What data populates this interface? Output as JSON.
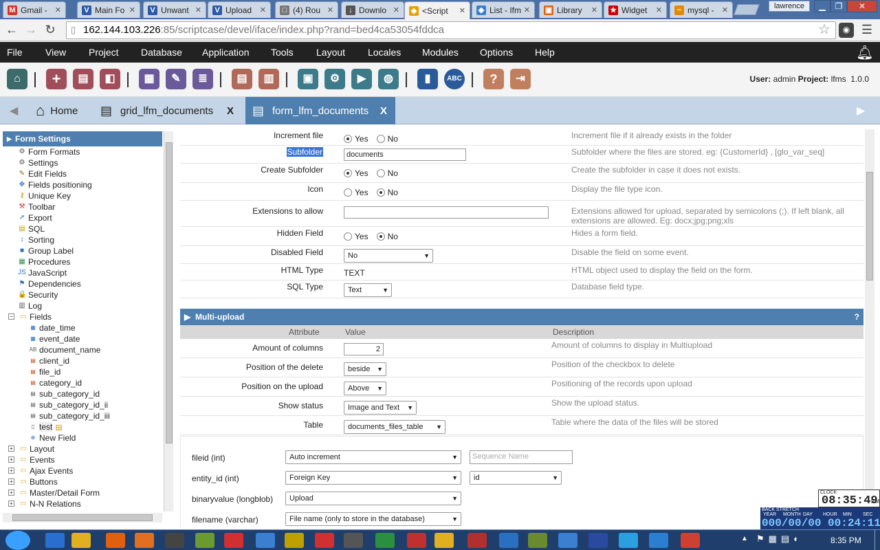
{
  "browser": {
    "tabs": [
      {
        "title": "Gmail -",
        "fav": "M",
        "color": "#d93025"
      },
      {
        "title": "Main Fo",
        "fav": "V",
        "color": "#2a5aa8"
      },
      {
        "title": "Unwant",
        "fav": "V",
        "color": "#2a5aa8"
      },
      {
        "title": "Upload",
        "fav": "V",
        "color": "#2a5aa8"
      },
      {
        "title": "(4) Rou",
        "fav": "□",
        "color": "#777"
      },
      {
        "title": "Downlo",
        "fav": "↓",
        "color": "#555"
      },
      {
        "title": "<Script",
        "fav": "◆",
        "color": "#e8a100"
      },
      {
        "title": "List - Ifm",
        "fav": "◆",
        "color": "#3a7fd0"
      },
      {
        "title": "Library",
        "fav": "▣",
        "color": "#e06010"
      },
      {
        "title": "Widget",
        "fav": "★",
        "color": "#c00"
      },
      {
        "title": "mysql -",
        "fav": "~",
        "color": "#e28b00"
      }
    ],
    "user": "lawrence",
    "url_host": "162.144.103.226",
    "url_path": ":85/scriptcase/devel/iface/index.php?rand=bed4ca53054fddca"
  },
  "menu": [
    "File",
    "View",
    "Project",
    "Database",
    "Application",
    "Tools",
    "Layout",
    "Locales",
    "Modules",
    "Options",
    "Help"
  ],
  "userinfo": {
    "user_label": "User:",
    "user": "admin",
    "project_label": "Project:",
    "project": "lfms",
    "version": "1.0.0"
  },
  "project_tabs": {
    "home": "Home",
    "grid": "grid_lfm_documents",
    "form": "form_lfm_documents",
    "close": "X"
  },
  "tree": {
    "header": "Form Settings",
    "items": [
      {
        "label": "Form Formats",
        "icon": "⚙",
        "c": "#555"
      },
      {
        "label": "Settings",
        "icon": "⚙",
        "c": "#555"
      },
      {
        "label": "Edit Fields",
        "icon": "✎",
        "c": "#a06000"
      },
      {
        "label": "Fields positioning",
        "icon": "✥",
        "c": "#2a70c0"
      },
      {
        "label": "Unique Key",
        "icon": "⚷",
        "c": "#c09000"
      },
      {
        "label": "Toolbar",
        "icon": "⚒",
        "c": "#c03030"
      },
      {
        "label": "Export",
        "icon": "➚",
        "c": "#2a70c0"
      },
      {
        "label": "SQL",
        "icon": "▤",
        "c": "#c0a000"
      },
      {
        "label": "Sorting",
        "icon": "↕",
        "c": "#2a70c0"
      },
      {
        "label": "Group Label",
        "icon": "■",
        "c": "#2a70c0"
      },
      {
        "label": "Procedures",
        "icon": "▦",
        "c": "#2a9040"
      },
      {
        "label": "JavaScript",
        "icon": "JS",
        "c": "#2a70c0"
      },
      {
        "label": "Dependencies",
        "icon": "⚑",
        "c": "#2a70c0"
      },
      {
        "label": "Security",
        "icon": "🔒",
        "c": "#c0a000"
      },
      {
        "label": "Log",
        "icon": "▥",
        "c": "#555"
      },
      {
        "label": "Fields",
        "icon": "▭",
        "c": "#e0b020"
      }
    ],
    "fields": [
      {
        "label": "date_time",
        "icon": "▦",
        "c": "#2a70c0"
      },
      {
        "label": "event_date",
        "icon": "▦",
        "c": "#2a70c0"
      },
      {
        "label": "document_name",
        "icon": "AB",
        "c": "#555"
      },
      {
        "label": "client_id",
        "icon": "▤",
        "c": "#c04000"
      },
      {
        "label": "file_id",
        "icon": "▤",
        "c": "#c04000"
      },
      {
        "label": "category_id",
        "icon": "▤",
        "c": "#c04000"
      },
      {
        "label": "sub_category_id",
        "icon": "▤",
        "c": "#555"
      },
      {
        "label": "sub_category_id_ii",
        "icon": "▤",
        "c": "#555"
      },
      {
        "label": "sub_category_id_iii",
        "icon": "▤",
        "c": "#555"
      },
      {
        "label": "test",
        "icon": "▯",
        "c": "#555"
      },
      {
        "label": "New Field",
        "icon": "⊕",
        "c": "#2a70c0"
      }
    ],
    "groups": [
      "Layout",
      "Events",
      "Ajax Events",
      "Buttons",
      "Master/Detail Form",
      "N-N Relations"
    ]
  },
  "form": {
    "rows": [
      {
        "label": "Increment file",
        "type": "radio",
        "selected": "Yes",
        "desc": "Increment file if it already exists in the folder"
      },
      {
        "label": "Subfolder",
        "type": "text",
        "value": "documents",
        "desc": "Subfolder where the files are stored. eg: {CustomerId} , [glo_var_seq]"
      },
      {
        "label": "Create Subfolder",
        "type": "radio",
        "selected": "Yes",
        "desc": "Create the subfolder in case it does not exists."
      },
      {
        "label": "Icon",
        "type": "radio",
        "selected": "No",
        "desc": "Display the file type icon."
      },
      {
        "label": "Extensions to allow",
        "type": "text",
        "value": "",
        "desc": "Extensions allowed for upload, separated by semicolons (;). If left blank, all extensions are allowed. Eg: docx;jpg;png;xls"
      },
      {
        "label": "Hidden Field",
        "type": "radio",
        "selected": "No",
        "desc": "Hides a form field."
      },
      {
        "label": "Disabled Field",
        "type": "select",
        "value": "No",
        "desc": "Disable the field on some event."
      },
      {
        "label": "HTML Type",
        "type": "static",
        "value": "TEXT",
        "desc": "HTML object used to display the field on the form."
      },
      {
        "label": "SQL Type",
        "type": "select",
        "value": "Text",
        "desc": "Database field type."
      }
    ],
    "yes": "Yes",
    "no": "No"
  },
  "multiupload": {
    "title": "Multi-upload",
    "help": "?",
    "headers": {
      "attribute": "Attribute",
      "value": "Value",
      "description": "Description"
    },
    "rows": [
      {
        "label": "Amount of columns",
        "type": "number",
        "value": "2",
        "desc": "Amount of columns to display in Multiupload"
      },
      {
        "label": "Position of the delete",
        "type": "select",
        "value": "beside",
        "desc": "Position of the checkbox to delete"
      },
      {
        "label": "Position on the upload",
        "type": "select",
        "value": "Above",
        "desc": "Positioning of the records upon upload"
      },
      {
        "label": "Show status",
        "type": "select",
        "value": "Image and Text",
        "desc": "Show the upload status."
      },
      {
        "label": "Table",
        "type": "select",
        "value": "documents_files_table",
        "desc": "Table where the data of the files will be stored"
      }
    ]
  },
  "storage": [
    {
      "field": "fileid (int)",
      "value": "Auto increment",
      "extra_type": "text",
      "extra_placeholder": "Sequence Name"
    },
    {
      "field": "entity_id (int)",
      "value": "Foreign Key",
      "extra_type": "select",
      "extra_value": "id"
    },
    {
      "field": "binaryvalue (longblob)",
      "value": "Upload"
    },
    {
      "field": "filename (varchar)",
      "value": "File name (only to store in the database)"
    }
  ],
  "clock": {
    "label": "CLOCK",
    "time": "08:35:49",
    "ampm": "PM",
    "bs_title": "BACK STRETCH",
    "bs_units": [
      "YEAR",
      "MONTH",
      "DAY",
      "HOUR",
      "MIN",
      "SEC"
    ],
    "bs_value": "000/00/00 00:24:11"
  },
  "taskbar": {
    "time": "8:35 PM"
  }
}
